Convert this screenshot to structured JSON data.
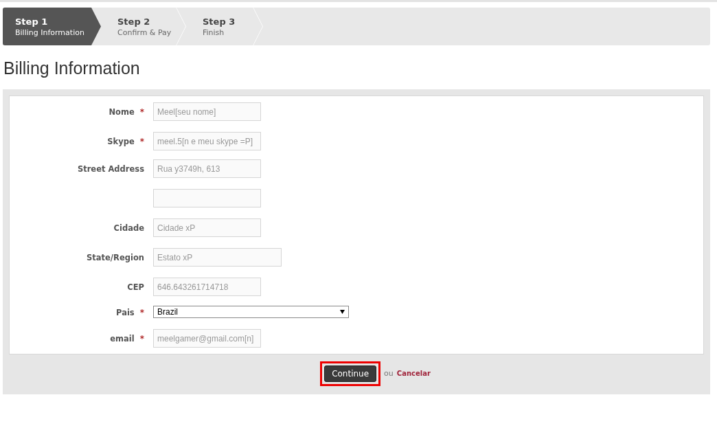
{
  "steps": [
    {
      "title": "Step 1",
      "subtitle": "Billing Information",
      "selected": true
    },
    {
      "title": "Step 2",
      "subtitle": "Confirm & Pay",
      "selected": false
    },
    {
      "title": "Step 3",
      "subtitle": "Finish",
      "selected": false
    }
  ],
  "heading": "Billing Information",
  "form_groups": [
    [
      {
        "label": "Nome",
        "required": true,
        "kind": "text",
        "placeholder": "Meel[seu nome]"
      },
      {
        "label": "Skype",
        "required": true,
        "kind": "text",
        "placeholder": "meel.5[n e meu skype =P]"
      }
    ],
    [
      {
        "label": "Street Address",
        "required": false,
        "kind": "text",
        "placeholder": "Rua y3749h, 613"
      },
      {
        "required": false,
        "kind": "text"
      },
      {
        "label": "Cidade",
        "required": false,
        "kind": "text",
        "placeholder": "Cidade xP"
      },
      {
        "label": "State/Region",
        "required": false,
        "kind": "wide",
        "placeholder": "Estato xP"
      },
      {
        "label": "CEP",
        "required": false,
        "kind": "text",
        "placeholder": "646.643261714718"
      },
      {
        "label": "Pais",
        "required": true,
        "kind": "select",
        "value": "Brazil"
      }
    ],
    [
      {
        "label": "email",
        "required": true,
        "kind": "text",
        "placeholder": "meelgamer@gmail.com[n]"
      }
    ]
  ],
  "required_mark": "*",
  "footer": {
    "button": "Continue",
    "highlighted": true,
    "or_text": "ou",
    "cancel_link": "Cancelar"
  }
}
